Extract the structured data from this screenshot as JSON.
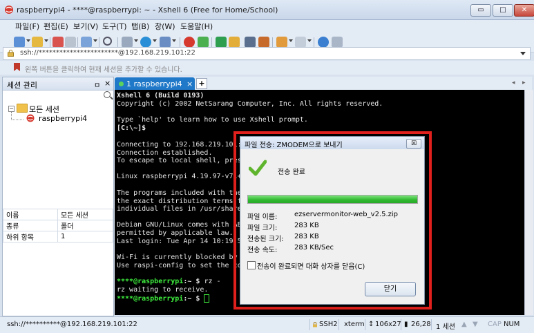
{
  "window": {
    "title": "raspberrypi4 - ****@raspberrypi: ~ - Xshell 6 (Free for Home/School)",
    "minimize_label": "▭",
    "maximize_label": "□",
    "close_label": "✕"
  },
  "menu": [
    "파일(F)",
    "편집(E)",
    "보기(V)",
    "도구(T)",
    "탭(B)",
    "창(W)",
    "도움말(H)"
  ],
  "address": {
    "value": "ssh://***********************@192.168.219.101:22"
  },
  "hint": "왼쪽 버튼을 클릭하여 현재 세션을 추가할 수 있습니다.",
  "session_panel": {
    "title": "세션 관리",
    "pin_label": "ㅁ",
    "close_label": "×",
    "tree_root": "모든 세션",
    "tree_child": "raspberrypi4",
    "expander": "−",
    "properties": [
      {
        "name": "이름",
        "value": "모든 세션"
      },
      {
        "name": "종류",
        "value": "폴더"
      },
      {
        "name": "하위 항목",
        "value": "1"
      }
    ]
  },
  "tabs": {
    "active_label": "1 raspberrypi4",
    "close_label": "×",
    "add_label": "+",
    "prev_label": "◂",
    "next_label": "▸"
  },
  "terminal": {
    "lines": [
      "Xshell 6 (Build 0193)",
      "Copyright (c) 2002 NetSarang Computer, Inc. All rights reserved.",
      "",
      "Type `help' to learn how to use Xshell prompt.",
      "[C:\\~]$",
      "",
      "Connecting to 192.168.219.101:2",
      "Connection established.",
      "To escape to local shell, press",
      "",
      "Linux raspberrypi 4.19.97-v7l+ #",
      "",
      "The programs included with the De",
      "the exact distribution terms for",
      "individual files in /usr/share/do",
      "",
      "Debian GNU/Linux comes with ABSOL",
      "permitted by applicable law.",
      "Last login: Tue Apr 14 10:19:51 2",
      "",
      "Wi-Fi is currently blocked by rf",
      "Use raspi-config to set the count",
      "",
      "",
      "rz waiting to receive.",
      ""
    ],
    "prompt_user": "****@raspberrypi",
    "prompt_suffix": ":~ $ ",
    "prompt_cmd": "rz -"
  },
  "status": {
    "address": "ssh://**********@192.168.219.101:22",
    "protocol": "SSH2",
    "terminal": "xterm",
    "size": "106x27",
    "cursor": "26,28",
    "sessions": "1 세션",
    "caps": "CAP",
    "num": "NUM"
  },
  "dialog": {
    "title": "파일 전송: ZMODEM으로 보내기",
    "close_label": "☒",
    "status": "전송 완료",
    "progress": 1.0,
    "fields": [
      {
        "label": "파일 이름:",
        "value": "ezservermonitor-web_v2.5.zip"
      },
      {
        "label": "파일 크기:",
        "value": "283 KB"
      },
      {
        "label": "전송된 크기:",
        "value": "283 KB"
      },
      {
        "label": "전송 속도:",
        "value": "283 KB/Sec"
      }
    ],
    "checkbox_label": "전송이 완료되면 대화 상자를 닫음(C)",
    "checkbox_checked": false,
    "button_label": "닫기"
  },
  "colors": {
    "accent": "#1f78c8",
    "highlight": "#e0201c",
    "prompt": "#3ef03e",
    "progress": "#2fb82f"
  }
}
